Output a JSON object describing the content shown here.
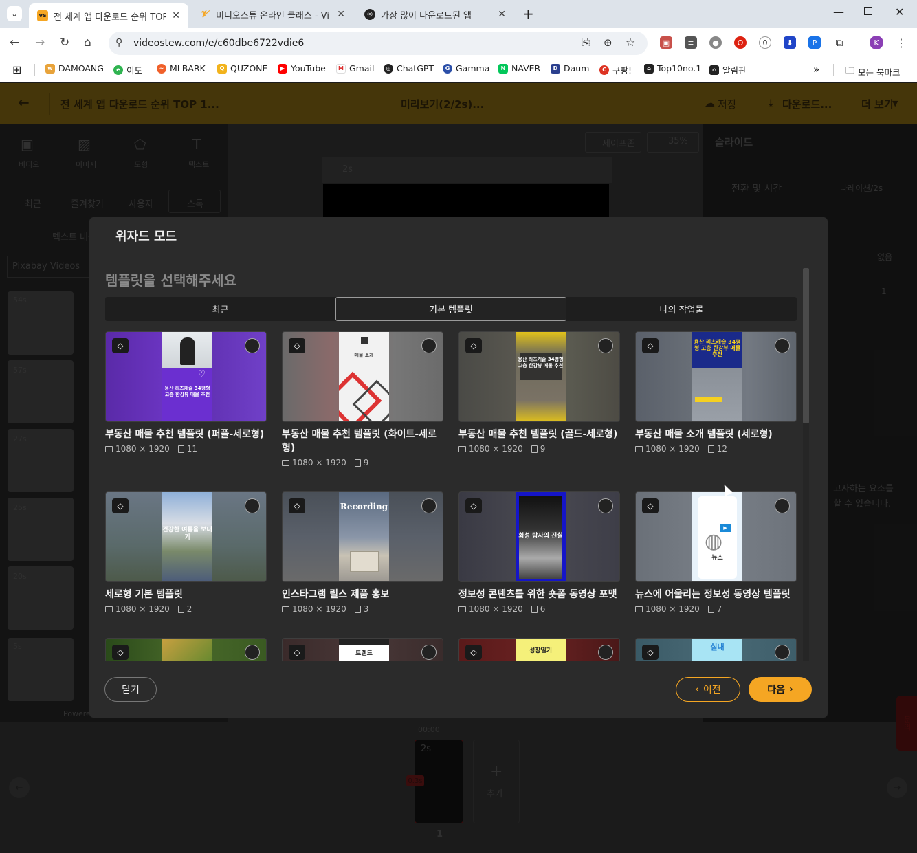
{
  "browser": {
    "tabs": [
      {
        "title": "전 세계 앱 다운로드 순위 TOP",
        "active": true
      },
      {
        "title": "비디오스튜 온라인 클래스 - Vi",
        "active": false
      },
      {
        "title": "가장 많이 다운로드된 앱",
        "active": false
      }
    ],
    "url": "videostew.com/e/c60dbe6722vdie6",
    "profile_initial": "K",
    "bookmarks": [
      "DAMOANG",
      "이토",
      "MLBARK",
      "QUZONE",
      "YouTube",
      "Gmail",
      "ChatGPT",
      "Gamma",
      "NAVER",
      "Daum",
      "쿠팡!",
      "Top10no.1",
      "알림판"
    ],
    "all_bookmarks": "모든 북마크",
    "colors": {
      "tabbar": "#dde3ea",
      "accent": "#f5a623"
    }
  },
  "app": {
    "header": {
      "title": "전 세계 앱 다운로드 순위 TOP 1...",
      "preview": "미리보기(2/2s)...",
      "save": "저장",
      "download": "다운로드...",
      "more": "더 보기"
    },
    "left": {
      "tools": [
        "비디오",
        "이미지",
        "도형",
        "텍스트"
      ],
      "tabs": [
        "최근",
        "즐겨찾기",
        "사용자",
        "스톡"
      ],
      "search_hint": "텍스트 내용",
      "source": "Pixabay Videos",
      "durations": [
        "54s",
        "57s",
        "27s",
        "25s",
        "20s",
        "5s"
      ],
      "powered": "Powered"
    },
    "toolbar": {
      "safezone": "세이프존",
      "zoom": "35%",
      "audio": "2s"
    },
    "right": {
      "section": "슬라이드",
      "row1": "전환 및 시간",
      "row1_value": "나레이션/2s",
      "row3_value": "없음",
      "row4_value": "1",
      "hint1": "고자하는 요소를",
      "hint2": "할 수 있습니다."
    },
    "timeline": {
      "time": "00:00",
      "clip": "2s",
      "badge": "0.3s",
      "add": "추가",
      "page": "1"
    },
    "side_tab": "문의"
  },
  "modal": {
    "title": "위자드 모드",
    "subtitle": "템플릿을 선택해주세요",
    "tabs": [
      "최근",
      "기본 템플릿",
      "나의 작업물"
    ],
    "selected_tab": 1,
    "templates": [
      {
        "title": "부동산 매물 추천 템플릿 (퍼플-세로형)",
        "size": "1080 × 1920",
        "pages": "11",
        "poster": "용산 리츠캐슬 34평형 고층 한강뷰 매물 추천"
      },
      {
        "title": "부동산 매물 추천 템플릿 (화이트-세로형)",
        "size": "1080 × 1920",
        "pages": "9",
        "poster": "매물 소개"
      },
      {
        "title": "부동산 매물 추천 템플릿 (골드-세로형)",
        "size": "1080 × 1920",
        "pages": "9",
        "poster": "용산 리츠캐슬 34평형 고층 한강뷰 매물 추천"
      },
      {
        "title": "부동산 매물 소개 템플릿 (세로형)",
        "size": "1080 × 1920",
        "pages": "12",
        "poster": "용산 리츠캐슬 34평형 고층 한강뷰 매물 추천"
      },
      {
        "title": "세로형 기본 템플릿",
        "size": "1080 × 1920",
        "pages": "2",
        "poster": "건강한 여름을 보내기"
      },
      {
        "title": "인스타그램 릴스 제품 홍보",
        "size": "1080 × 1920",
        "pages": "3",
        "poster": "Recording"
      },
      {
        "title": "정보성 콘텐츠를 위한 숏폼 동영상 포맷",
        "size": "1080 × 1920",
        "pages": "6",
        "poster": "화성 탐사의 진실"
      },
      {
        "title": "뉴스에 어울리는 정보성 동영상 템플릿",
        "size": "1080 × 1920",
        "pages": "7",
        "poster": "뉴스"
      },
      {
        "title": "",
        "size": "",
        "pages": "",
        "poster": ""
      },
      {
        "title": "",
        "size": "",
        "pages": "",
        "poster": "트렌드"
      },
      {
        "title": "",
        "size": "",
        "pages": "",
        "poster": "성장일기"
      },
      {
        "title": "",
        "size": "",
        "pages": "",
        "poster": "실내"
      }
    ],
    "close": "닫기",
    "prev": "이전",
    "next": "다음"
  }
}
